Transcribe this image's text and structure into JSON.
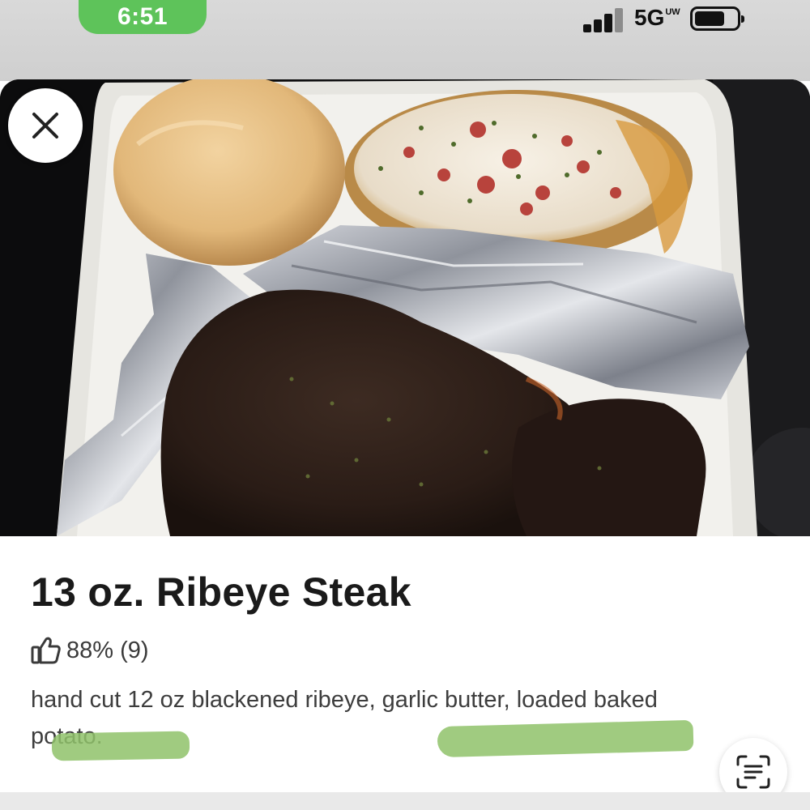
{
  "status_bar": {
    "time": "6:51",
    "network": "5G",
    "network_badge": "UW",
    "time_pill_color": "#5ec35a",
    "battery_level_fraction": 0.72,
    "signal_bars_active": 3,
    "signal_bars_total": 4
  },
  "photo": {
    "close_icon": "close-icon"
  },
  "item": {
    "title": "13 oz. Ribeye Steak",
    "rating_icon": "thumbs-up-icon",
    "rating_text": "88% (9)",
    "description": "hand cut 12 oz blackened ribeye, garlic butter, loaded baked potato."
  },
  "actions": {
    "scan_icon": "scan-text-icon"
  },
  "colors": {
    "highlight_marker": "#8fc26a",
    "title_text": "#1a1a1a",
    "body_text": "#3d3d3d"
  }
}
